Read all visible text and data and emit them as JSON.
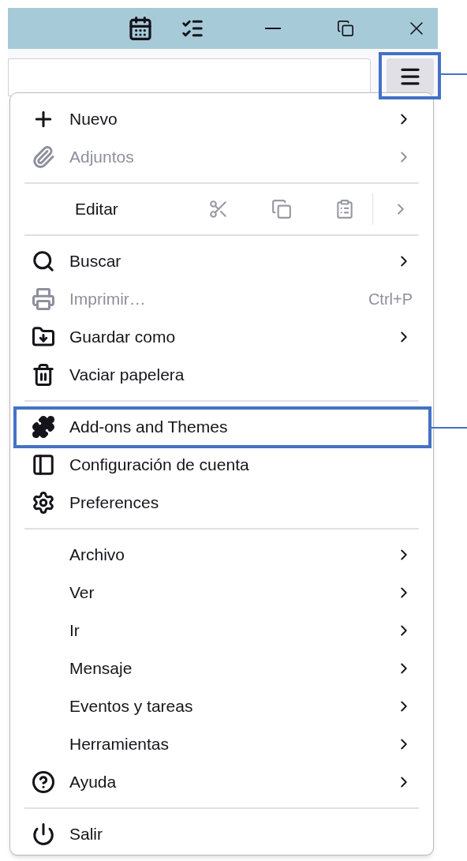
{
  "menu_button": {
    "annotated": true
  },
  "menu": {
    "sections": [
      [
        {
          "kind": "item",
          "label": "Nuevo",
          "disabled": false,
          "submenu": true,
          "annotated": false
        },
        {
          "kind": "item",
          "label": "Adjuntos",
          "disabled": true,
          "submenu": true,
          "annotated": false
        }
      ],
      [
        {
          "kind": "edit",
          "label": "Editar",
          "disabled": true,
          "submenu": true,
          "annotated": false
        }
      ],
      [
        {
          "kind": "item",
          "label": "Buscar",
          "disabled": false,
          "submenu": true,
          "annotated": false
        },
        {
          "kind": "item",
          "label": "Imprimir…",
          "disabled": true,
          "submenu": false,
          "shortcut": "Ctrl+P",
          "annotated": false
        },
        {
          "kind": "item",
          "label": "Guardar como",
          "disabled": false,
          "submenu": true,
          "annotated": false
        },
        {
          "kind": "item",
          "label": "Vaciar papelera",
          "disabled": false,
          "submenu": false,
          "annotated": false
        }
      ],
      [
        {
          "kind": "item",
          "label": "Add-ons and Themes",
          "disabled": false,
          "submenu": false,
          "annotated": true
        },
        {
          "kind": "item",
          "label": "Configuración de cuenta",
          "disabled": false,
          "submenu": false,
          "annotated": false
        },
        {
          "kind": "item",
          "label": "Preferences",
          "disabled": false,
          "submenu": false,
          "annotated": false
        }
      ],
      [
        {
          "kind": "item",
          "label": "Archivo",
          "disabled": false,
          "submenu": true,
          "annotated": false
        },
        {
          "kind": "item",
          "label": "Ver",
          "disabled": false,
          "submenu": true,
          "annotated": false
        },
        {
          "kind": "item",
          "label": "Ir",
          "disabled": false,
          "submenu": true,
          "annotated": false
        },
        {
          "kind": "item",
          "label": "Mensaje",
          "disabled": false,
          "submenu": true,
          "annotated": false
        },
        {
          "kind": "item",
          "label": "Eventos y tareas",
          "disabled": false,
          "submenu": true,
          "annotated": false
        },
        {
          "kind": "item",
          "label": "Herramientas",
          "disabled": false,
          "submenu": true,
          "annotated": false
        },
        {
          "kind": "item",
          "label": "Ayuda",
          "disabled": false,
          "submenu": true,
          "annotated": false
        }
      ],
      [
        {
          "kind": "item",
          "label": "Salir",
          "disabled": false,
          "submenu": false,
          "annotated": false
        }
      ]
    ]
  }
}
